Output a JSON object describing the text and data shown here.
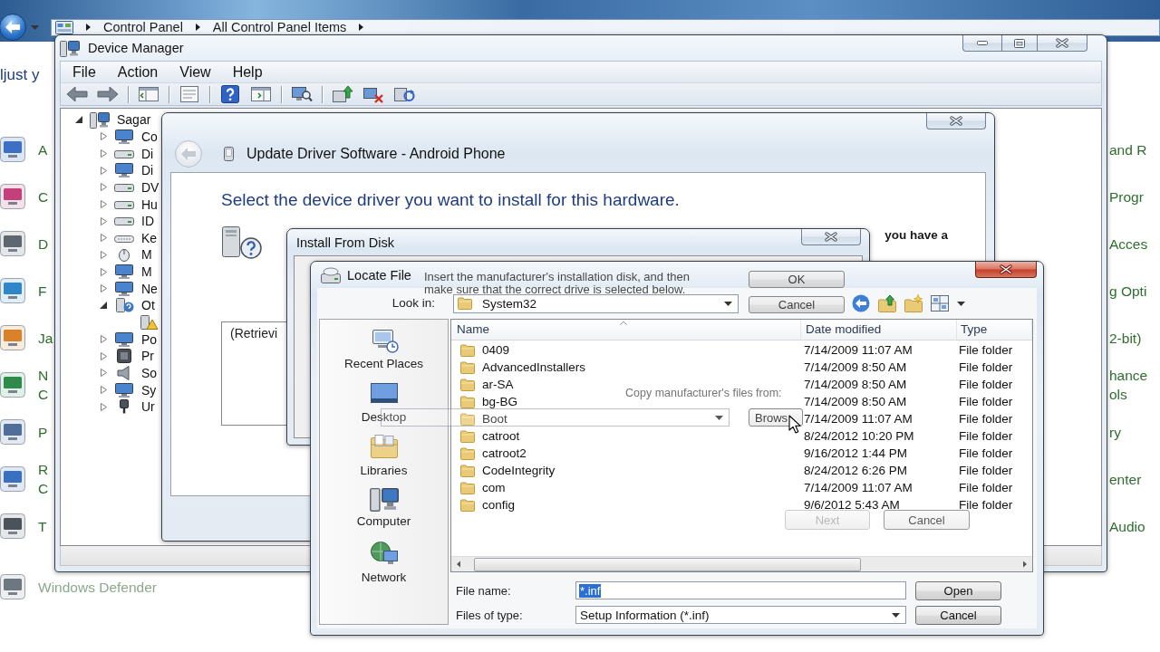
{
  "control_panel": {
    "address": [
      "Control Panel",
      "All Control Panel Items"
    ],
    "heading": "ljust y",
    "left_items": [
      {
        "lines": [
          "A"
        ]
      },
      {
        "lines": [
          "C"
        ]
      },
      {
        "lines": [
          "D"
        ]
      },
      {
        "lines": [
          "F"
        ]
      },
      {
        "lines": [
          "Ja"
        ]
      },
      {
        "lines": [
          "N",
          "C"
        ]
      },
      {
        "lines": [
          "P"
        ]
      },
      {
        "lines": [
          "R",
          "C"
        ]
      },
      {
        "lines": [
          "T"
        ]
      }
    ],
    "bottom_item": "Windows Defender",
    "right_items": [
      {
        "lines": [
          "and R"
        ]
      },
      {
        "lines": [
          "Progr"
        ]
      },
      {
        "lines": [
          "Acces"
        ]
      },
      {
        "lines": [
          "g Opti"
        ]
      },
      {
        "lines": [
          "2-bit)"
        ]
      },
      {
        "lines": [
          "hance",
          "ols"
        ]
      },
      {
        "lines": [
          "ry"
        ]
      },
      {
        "lines": [
          "enter"
        ]
      },
      {
        "lines": [
          "Audio"
        ]
      }
    ]
  },
  "device_manager": {
    "title": "Device Manager",
    "menu": [
      "File",
      "Action",
      "View",
      "Help"
    ],
    "tree": {
      "kind": "computer",
      "label": "Sagar",
      "expanded": true,
      "children": [
        {
          "kind": "category",
          "label": "Co",
          "expanded": false
        },
        {
          "kind": "category",
          "label": "Di",
          "expanded": false
        },
        {
          "kind": "category",
          "label": "Di",
          "expanded": false
        },
        {
          "kind": "category",
          "label": "DV",
          "expanded": false
        },
        {
          "kind": "category",
          "label": "Hu",
          "expanded": false
        },
        {
          "kind": "category",
          "label": "ID",
          "expanded": false
        },
        {
          "kind": "category",
          "label": "Ke",
          "expanded": false
        },
        {
          "kind": "category",
          "label": "M",
          "expanded": false
        },
        {
          "kind": "category",
          "label": "M",
          "expanded": false
        },
        {
          "kind": "category",
          "label": "Ne",
          "expanded": false
        },
        {
          "kind": "category",
          "label": "Ot",
          "expanded": true,
          "children": [
            {
              "kind": "device"
            }
          ]
        },
        {
          "kind": "category",
          "label": "Po",
          "expanded": false
        },
        {
          "kind": "category",
          "label": "Pr",
          "expanded": false
        },
        {
          "kind": "category",
          "label": "So",
          "expanded": false
        },
        {
          "kind": "category",
          "label": "Sy",
          "expanded": false
        },
        {
          "kind": "category",
          "label": "Ur",
          "expanded": false
        }
      ]
    }
  },
  "update_driver": {
    "title": "Update Driver Software - Android Phone",
    "back_disabled": true,
    "heading": "Select the device driver you want to install for this hardware.",
    "description": "you have a",
    "list_text": "(Retrievi",
    "buttons": [
      {
        "label": "Next",
        "disabled": true
      },
      {
        "label": "Cancel",
        "disabled": false
      }
    ]
  },
  "install_from_disk": {
    "title": "Install From Disk",
    "instructions": [
      "Insert the manufacturer's installation disk, and then",
      "make sure that the correct drive is selected below."
    ],
    "buttons": [
      "OK",
      "Cancel"
    ],
    "copy_label": "Copy manufacturer's files from:",
    "browse_button": "Brows"
  },
  "locate_file": {
    "title": "Locate File",
    "look_in": {
      "label": "Look in:",
      "value": "System32"
    },
    "places": [
      "Recent Places",
      "Desktop",
      "Libraries",
      "Computer",
      "Network"
    ],
    "columns": [
      "Name",
      "Date modified",
      "Type"
    ],
    "rows": [
      {
        "name": "0409",
        "date": "7/14/2009 11:07 AM",
        "type": "File folder"
      },
      {
        "name": "AdvancedInstallers",
        "date": "7/14/2009 8:50 AM",
        "type": "File folder"
      },
      {
        "name": "ar-SA",
        "date": "7/14/2009 8:50 AM",
        "type": "File folder"
      },
      {
        "name": "bg-BG",
        "date": "7/14/2009 8:50 AM",
        "type": "File folder"
      },
      {
        "name": "Boot",
        "date": "7/14/2009 11:07 AM",
        "type": "File folder"
      },
      {
        "name": "catroot",
        "date": "8/24/2012 10:20 PM",
        "type": "File folder"
      },
      {
        "name": "catroot2",
        "date": "9/16/2012 1:44 PM",
        "type": "File folder"
      },
      {
        "name": "CodeIntegrity",
        "date": "8/24/2012 6:26 PM",
        "type": "File folder"
      },
      {
        "name": "com",
        "date": "7/14/2009 11:07 AM",
        "type": "File folder"
      },
      {
        "name": "config",
        "date": "9/6/2012 5:43 AM",
        "type": "File folder"
      }
    ],
    "file_name": {
      "label": "File name:",
      "value": "*.inf",
      "text_selected": true
    },
    "file_type": {
      "label": "Files of type:",
      "value": "Setup Information (*.inf)"
    },
    "buttons": [
      "Open",
      "Cancel"
    ]
  }
}
